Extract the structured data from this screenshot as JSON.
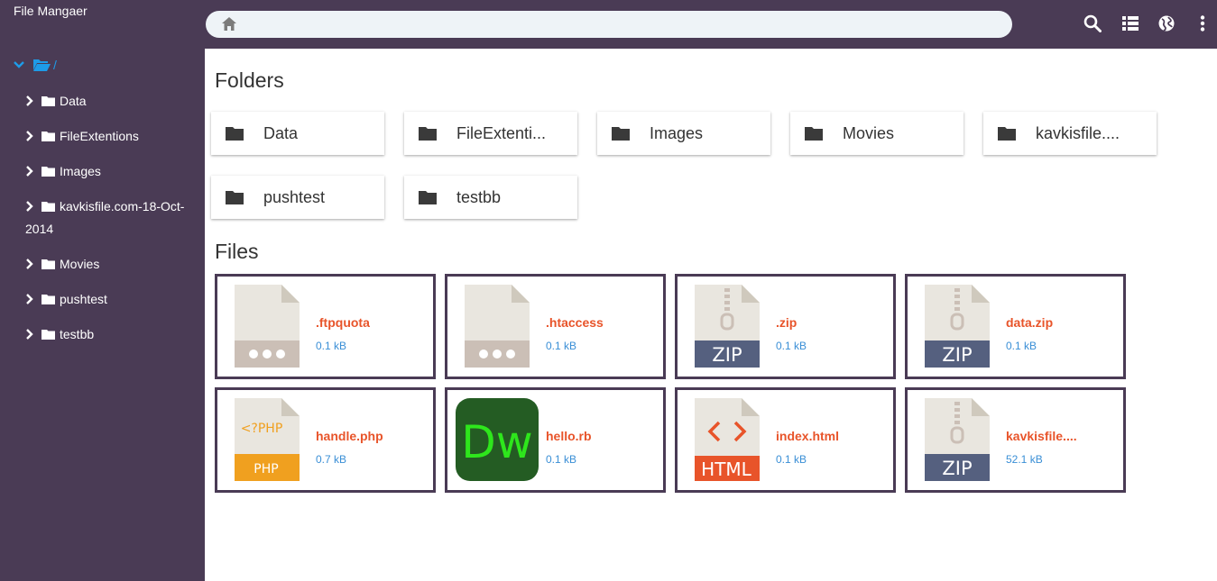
{
  "app": {
    "title": "File Mangaer"
  },
  "tree": {
    "root_label": "/",
    "items": [
      {
        "label": "Data"
      },
      {
        "label": "FileExtentions"
      },
      {
        "label": "Images"
      },
      {
        "label": "kavkisfile.com-18-Oct-2014"
      },
      {
        "label": "Movies"
      },
      {
        "label": "pushtest"
      },
      {
        "label": "testbb"
      }
    ]
  },
  "toolbar": {
    "home_icon": "home-icon",
    "search_icon": "search-icon",
    "list_view_icon": "list-view-icon",
    "globe_icon": "globe-icon",
    "more_icon": "more-vertical-icon"
  },
  "main": {
    "folders_heading": "Folders",
    "files_heading": "Files",
    "folders": [
      {
        "label": "Data"
      },
      {
        "label": "FileExtenti..."
      },
      {
        "label": "Images"
      },
      {
        "label": "Movies"
      },
      {
        "label": "kavkisfile...."
      },
      {
        "label": "pushtest"
      },
      {
        "label": "testbb"
      }
    ],
    "files": [
      {
        "name": ".ftpquota",
        "size": "0.1 kB",
        "icon": "generic-file-icon"
      },
      {
        "name": ".htaccess",
        "size": "0.1 kB",
        "icon": "generic-file-icon"
      },
      {
        "name": ".zip",
        "size": "0.1 kB",
        "icon": "zip-file-icon",
        "badge": "ZIP"
      },
      {
        "name": "data.zip",
        "size": "0.1 kB",
        "icon": "zip-file-icon",
        "badge": "ZIP"
      },
      {
        "name": "handle.php",
        "size": "0.7 kB",
        "icon": "php-file-icon",
        "badge": "PHP",
        "tag": "<?PHP"
      },
      {
        "name": "hello.rb",
        "size": "0.1 kB",
        "icon": "dreamweaver-icon",
        "badge": "Dw"
      },
      {
        "name": "index.html",
        "size": "0.1 kB",
        "icon": "html-file-icon",
        "badge": "HTML",
        "tag": "< >"
      },
      {
        "name": "kavkisfile....",
        "size": "52.1 kB",
        "icon": "zip-file-icon",
        "badge": "ZIP"
      }
    ]
  },
  "colors": {
    "sidebar_bg": "#4a3b55",
    "accent_blue": "#1e9be8",
    "file_name": "#e8542a",
    "file_size": "#3a8fd6",
    "zip_badge": "#55607f",
    "php_badge": "#f0a01f",
    "html_badge": "#e8542a",
    "dw_bg": "#245c23",
    "dw_text": "#2ee61c"
  }
}
